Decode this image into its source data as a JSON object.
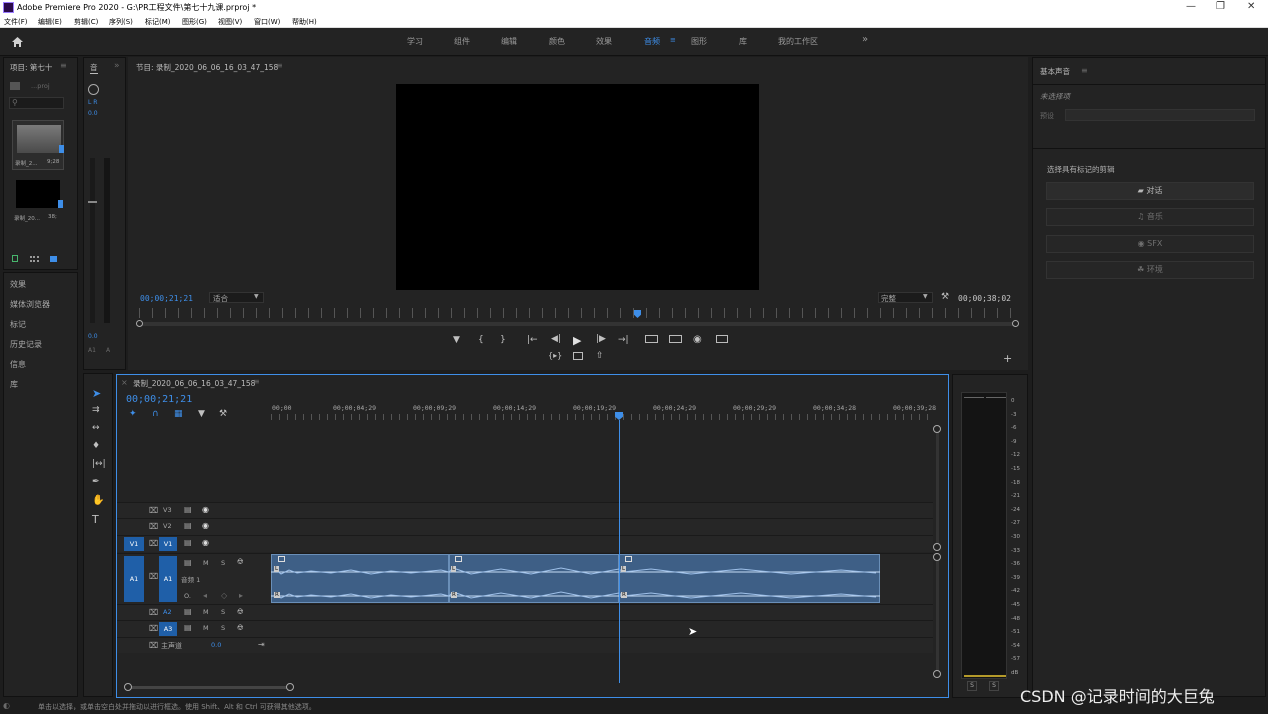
{
  "app": {
    "title": "Adobe Premiere Pro 2020 - G:\\PR工程文件\\第七十九课.prproj *"
  },
  "menu": [
    "文件(F)",
    "编辑(E)",
    "剪辑(C)",
    "序列(S)",
    "标记(M)",
    "图形(G)",
    "视图(V)",
    "窗口(W)",
    "帮助(H)"
  ],
  "workspaces": [
    "学习",
    "组件",
    "编辑",
    "颜色",
    "效果",
    "音频",
    "图形",
    "库",
    "我的工作区"
  ],
  "workspace_active": "音频",
  "project": {
    "title": "项目: 第七十",
    "file": "...proj",
    "items": [
      {
        "name": "录制_2...",
        "dur": "9;28"
      },
      {
        "name": "录制_20...",
        "dur": "38;"
      }
    ]
  },
  "left_tabs": [
    "效果",
    "媒体浏览器",
    "标记",
    "历史记录",
    "信息",
    "库"
  ],
  "mixer": {
    "tab": "音",
    "lr": "L R",
    "val": "0.0",
    "val2": "0.0",
    "chan1": "A1",
    "chan2": "A"
  },
  "program": {
    "title": "节目: 录制_2020_06_06_16_03_47_158",
    "timecode": "00;00;21;21",
    "fit": "适合",
    "quality": "完整",
    "duration": "00;00;38;02"
  },
  "timeline": {
    "title": "录制_2020_06_06_16_03_47_158",
    "timecode": "00;00;21;21",
    "ruler": [
      "00;00",
      "00;00;04;29",
      "00;00;09;29",
      "00;00;14;29",
      "00;00;19;29",
      "00;00;24;29",
      "00;00;29;29",
      "00;00;34;28",
      "00;00;39;28"
    ],
    "tracks": {
      "v3": "V3",
      "v2": "V2",
      "v1": "V1",
      "v1src": "V1",
      "a1": "A1",
      "a1src": "A1",
      "a1name": "音频 1",
      "a2": "A2",
      "a3": "A3",
      "master": "主声道",
      "master_val": "0.0",
      "m": "M",
      "s": "S",
      "o_knob": "O."
    },
    "clip_labels": [
      "L",
      "L",
      "L",
      "R",
      "R",
      "R"
    ]
  },
  "meter_scale": [
    "0",
    "-3",
    "-6",
    "-9",
    "-12",
    "-15",
    "-18",
    "-21",
    "-24",
    "-27",
    "-30",
    "-33",
    "-36",
    "-39",
    "-42",
    "-45",
    "-48",
    "-51",
    "-54",
    "-57",
    "dB"
  ],
  "meter_solo": [
    "S",
    "S"
  ],
  "essential_sound": {
    "title": "基本声音",
    "subtitle": "未选择项",
    "preset_label": "预设",
    "select_label": "选择具有标记的剪辑",
    "buttons": [
      "对话",
      "音乐",
      "SFX",
      "环境"
    ]
  },
  "status": {
    "text": "单击以选择，或单击空白处并拖动以进行框选。使用 Shift、Alt 和 Ctrl 可获得其他选项。",
    "watermark": "CSDN @记录时间的大巨兔"
  },
  "colors": {
    "accent": "#3e8ee8",
    "clip": "#3e5f86",
    "target": "#1f5fa8"
  }
}
